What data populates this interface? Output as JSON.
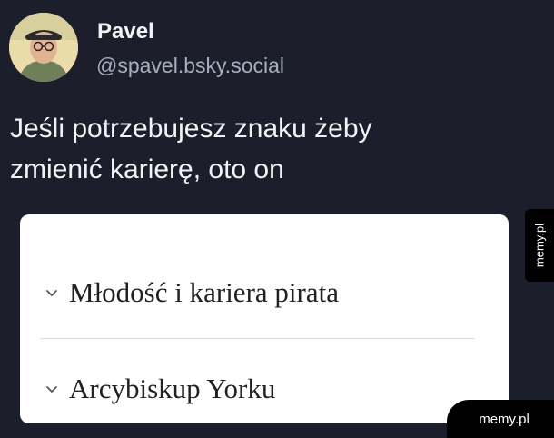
{
  "post": {
    "author_name": "Pavel",
    "handle": "@spavel.bsky.social",
    "text_line1": "Jeśli potrzebujesz znaku żeby",
    "text_line2": "zmienić karierę, oto on"
  },
  "embedded_card": {
    "items": [
      {
        "label": "Młodość i kariera pirata",
        "icon": "chevron-down-icon"
      },
      {
        "label": "Arcybiskup Yorku",
        "icon": "chevron-down-icon"
      }
    ]
  },
  "watermarks": {
    "side_tab": "memy.pl",
    "corner": "memy.pl"
  },
  "colors": {
    "background": "#1c1f2b",
    "text_primary": "#f1f3f5",
    "text_secondary": "#a7afbd",
    "card_bg": "#ffffff"
  }
}
